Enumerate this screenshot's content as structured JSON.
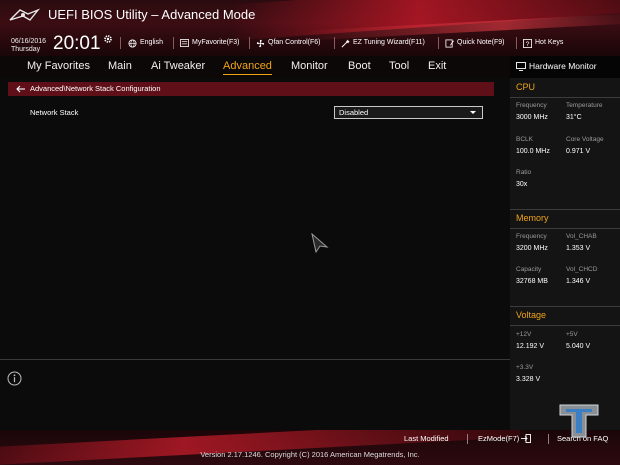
{
  "header": {
    "title": "UEFI BIOS Utility – Advanced Mode",
    "date": "06/16/2016",
    "weekday": "Thursday",
    "time": "20:01",
    "items": [
      {
        "label": "English",
        "icon": "globe-icon"
      },
      {
        "label": "MyFavorite(F3)",
        "icon": "favorite-icon"
      },
      {
        "label": "Qfan Control(F6)",
        "icon": "fan-icon"
      },
      {
        "label": "EZ Tuning Wizard(F11)",
        "icon": "wizard-icon"
      },
      {
        "label": "Quick Note(F9)",
        "icon": "note-icon"
      },
      {
        "label": "Hot Keys",
        "icon": "help-icon"
      }
    ]
  },
  "nav": {
    "tabs": [
      {
        "label": "My Favorites"
      },
      {
        "label": "Main"
      },
      {
        "label": "Ai Tweaker"
      },
      {
        "label": "Advanced"
      },
      {
        "label": "Monitor"
      },
      {
        "label": "Boot"
      },
      {
        "label": "Tool"
      },
      {
        "label": "Exit"
      }
    ],
    "active": "Advanced"
  },
  "main": {
    "breadcrumb": "Advanced\\Network Stack Configuration",
    "setting": {
      "label": "Network Stack",
      "value": "Disabled"
    }
  },
  "hardware_monitor": {
    "title": "Hardware Monitor",
    "cpu": {
      "title": "CPU",
      "frequency_label": "Frequency",
      "frequency": "3000 MHz",
      "temperature_label": "Temperature",
      "temperature": "31°C",
      "bclk_label": "BCLK",
      "bclk": "100.0 MHz",
      "core_voltage_label": "Core Voltage",
      "core_voltage": "0.971 V",
      "ratio_label": "Ratio",
      "ratio": "30x"
    },
    "memory": {
      "title": "Memory",
      "frequency_label": "Frequency",
      "frequency": "3200 MHz",
      "vol_chab_label": "Vol_CHAB",
      "vol_chab": "1.353 V",
      "capacity_label": "Capacity",
      "capacity": "32768 MB",
      "vol_chcd_label": "Vol_CHCD",
      "vol_chcd": "1.346 V"
    },
    "voltage": {
      "title": "Voltage",
      "v12_label": "+12V",
      "v12": "12.192 V",
      "v5_label": "+5V",
      "v5": "5.040 V",
      "v33_label": "+3.3V",
      "v33": "3.328 V"
    }
  },
  "footer": {
    "last_modified": "Last Modified",
    "ezmode": "EzMode(F7)",
    "search": "Search on FAQ",
    "version": "Version 2.17.1246. Copyright (C) 2016 American Megatrends, Inc."
  },
  "colors": {
    "accent": "#f0a318",
    "brand_red": "#5e0f17"
  }
}
